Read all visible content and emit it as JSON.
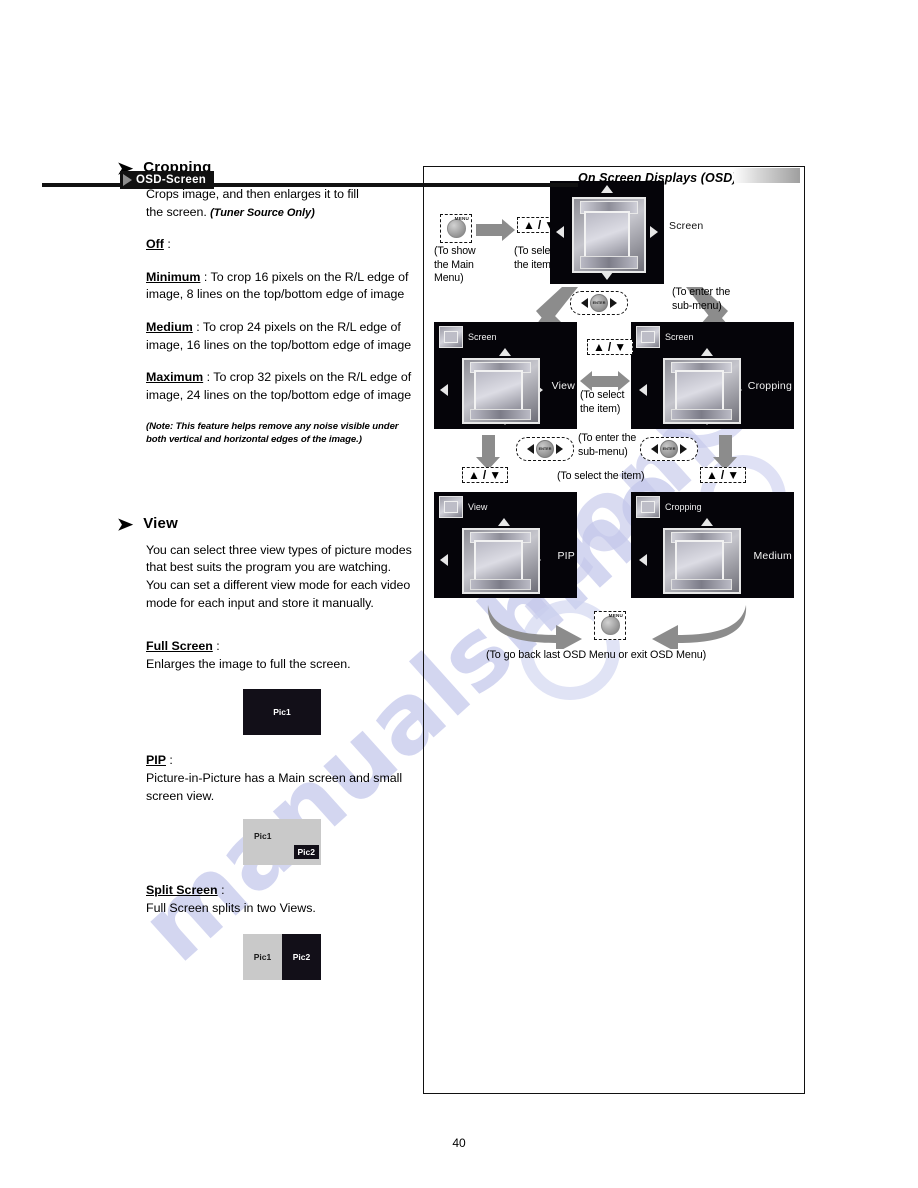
{
  "header": {
    "tab_label": "OSD-Screen",
    "chapter_title": "On Screen Displays (OSD)"
  },
  "footer": {
    "page_number": "40"
  },
  "watermark": {
    "line1": "manualshine",
    "line2": ".com"
  },
  "sections": [
    {
      "title": "Cropping",
      "intro_line1": "Crops image, and then enlarges it to fill",
      "intro_line2": "the screen.",
      "intro_note": "(Tuner Source Only)",
      "options": [
        {
          "term": "Off",
          "sep": " :",
          "desc": ""
        },
        {
          "term": "Minimum",
          "sep": " :",
          "desc": " To crop 16 pixels on the R/L edge of image, 8 lines on the top/bottom edge of image"
        },
        {
          "term": "Medium",
          "sep": " :",
          "desc": " To crop 24 pixels on the R/L edge of image, 16 lines on the top/bottom edge of image"
        },
        {
          "term": "Maximum",
          "sep": " :",
          "desc": " To crop 32 pixels on the R/L edge of image, 24 lines on the top/bottom edge of image"
        }
      ],
      "note": "(Note: This feature helps remove any noise visible under both vertical and horizontal edges of the image.)"
    },
    {
      "title": "View",
      "paragraph": "You can select three view types of picture modes that best suits the program you are watching. You can set a different view mode for each video mode for each input and store it manually.",
      "view_modes": [
        {
          "term": "Full Screen",
          "sep": " :",
          "desc": "Enlarges the image to full the screen.",
          "sample_type": "full",
          "labels": [
            "Pic1"
          ]
        },
        {
          "term": "PIP",
          "sep": " :",
          "desc": "Picture-in-Picture has a Main screen and small screen view.",
          "sample_type": "pip",
          "labels": [
            "Pic1",
            "Pic2"
          ]
        },
        {
          "term": "Split Screen",
          "sep": " :",
          "desc": "Full Screen splits in two Views.",
          "sample_type": "split",
          "labels": [
            "Pic1",
            "Pic2"
          ]
        }
      ]
    }
  ],
  "diagram": {
    "keys": {
      "menu_label": "MENU",
      "enter_label": "ENTER",
      "updown_up": "▲",
      "updown_slash": "/",
      "updown_down": "▼"
    },
    "captions": {
      "show_main_menu": "(To show\nthe Main\nMenu)",
      "show_main_menu_l1": "(To show",
      "show_main_menu_l2": "the Main",
      "show_main_menu_l3": "Menu)",
      "select_item_l1": "(To select",
      "select_item_l2": "the item)",
      "enter_submenu_l1": "(To enter the",
      "enter_submenu_l2": "sub-menu)",
      "select_item_inline": "(To select the item)",
      "go_back": "(To go back last OSD Menu or exit OSD Menu)"
    },
    "screens": [
      {
        "id": "screen-main",
        "breadcrumb": "",
        "value": "Screen"
      },
      {
        "id": "screen-view",
        "breadcrumb": "Screen",
        "value": "View"
      },
      {
        "id": "screen-cropping",
        "breadcrumb": "Screen",
        "value": "Cropping"
      },
      {
        "id": "screen-pip",
        "breadcrumb": "View",
        "value": "PIP"
      },
      {
        "id": "screen-medium",
        "breadcrumb": "Cropping",
        "value": "Medium"
      }
    ]
  }
}
